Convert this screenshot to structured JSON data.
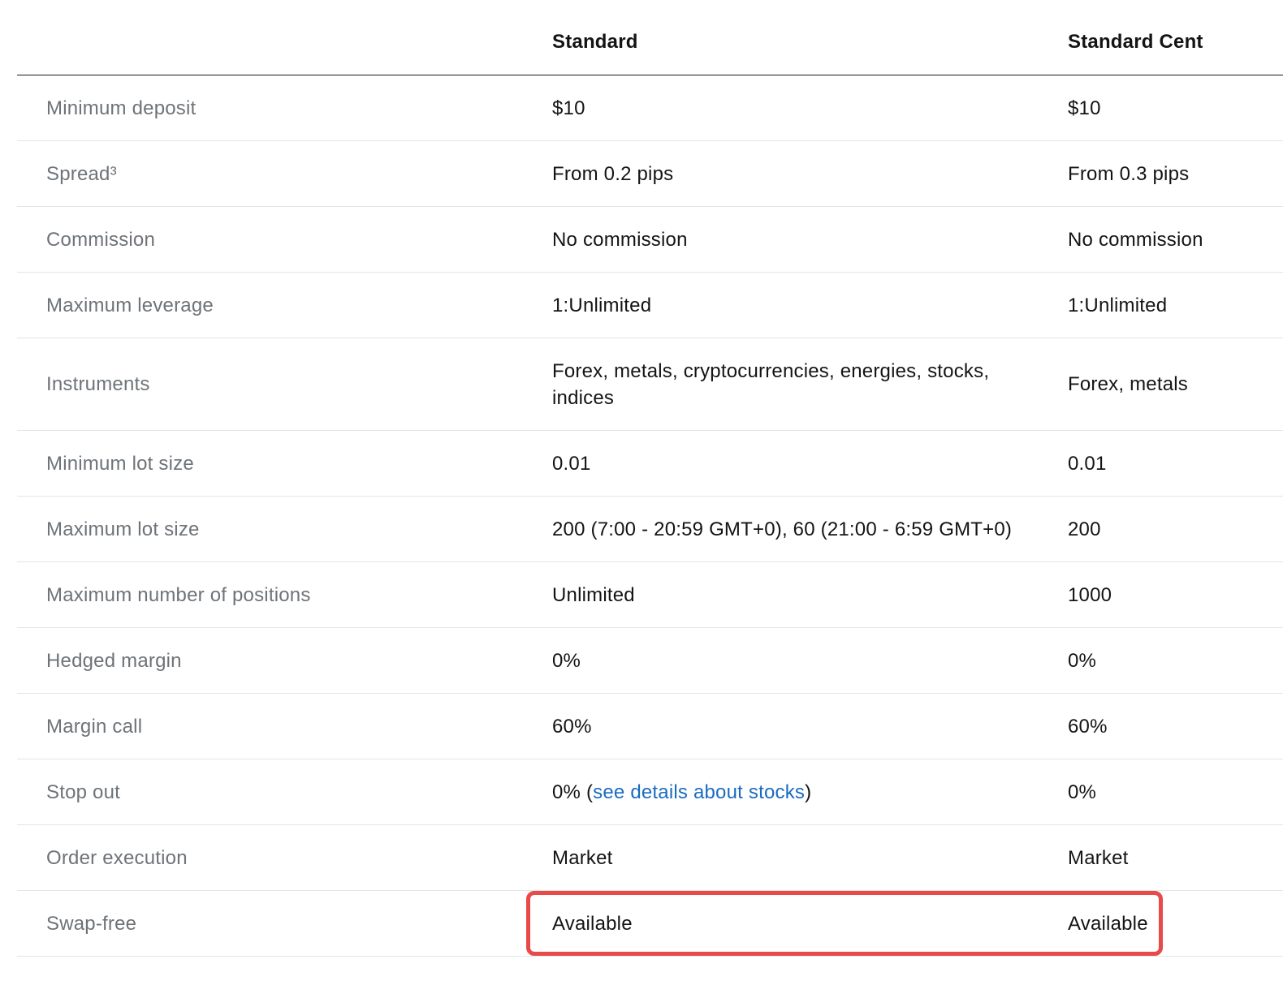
{
  "header": {
    "col_standard": "Standard",
    "col_standard_cent": "Standard Cent"
  },
  "rows": [
    {
      "label": "Minimum deposit",
      "standard": "$10",
      "cent": "$10"
    },
    {
      "label": "Spread³",
      "standard": "From 0.2 pips",
      "cent": "From 0.3 pips"
    },
    {
      "label": "Commission",
      "standard": "No commission",
      "cent": "No commission"
    },
    {
      "label": "Maximum leverage",
      "standard": "1:Unlimited",
      "cent": "1:Unlimited"
    },
    {
      "label": "Instruments",
      "standard_line1": "Forex, metals, cryptocurrencies, energies, stocks,",
      "standard_line2": "indices",
      "cent": "Forex, metals"
    },
    {
      "label": "Minimum lot size",
      "standard": "0.01",
      "cent": "0.01"
    },
    {
      "label": "Maximum lot size",
      "standard": "200 (7:00 - 20:59 GMT+0), 60 (21:00 - 6:59 GMT+0)",
      "cent": "200"
    },
    {
      "label": "Maximum number of positions",
      "standard": "Unlimited",
      "cent": "1000"
    },
    {
      "label": "Hedged margin",
      "standard": "0%",
      "cent": "0%"
    },
    {
      "label": "Margin call",
      "standard": "60%",
      "cent": "60%"
    },
    {
      "label": "Stop out",
      "standard_prefix": "0% (",
      "standard_link": "see details about stocks",
      "standard_suffix": ")",
      "cent": "0%"
    },
    {
      "label": "Order execution",
      "standard": "Market",
      "cent": "Market"
    },
    {
      "label": "Swap-free",
      "standard": "Available",
      "cent": "Available"
    }
  ],
  "colors": {
    "label_text": "#6e7378",
    "value_text": "#141414",
    "link": "#1a6cc1",
    "highlight_border": "#e84a4a"
  }
}
